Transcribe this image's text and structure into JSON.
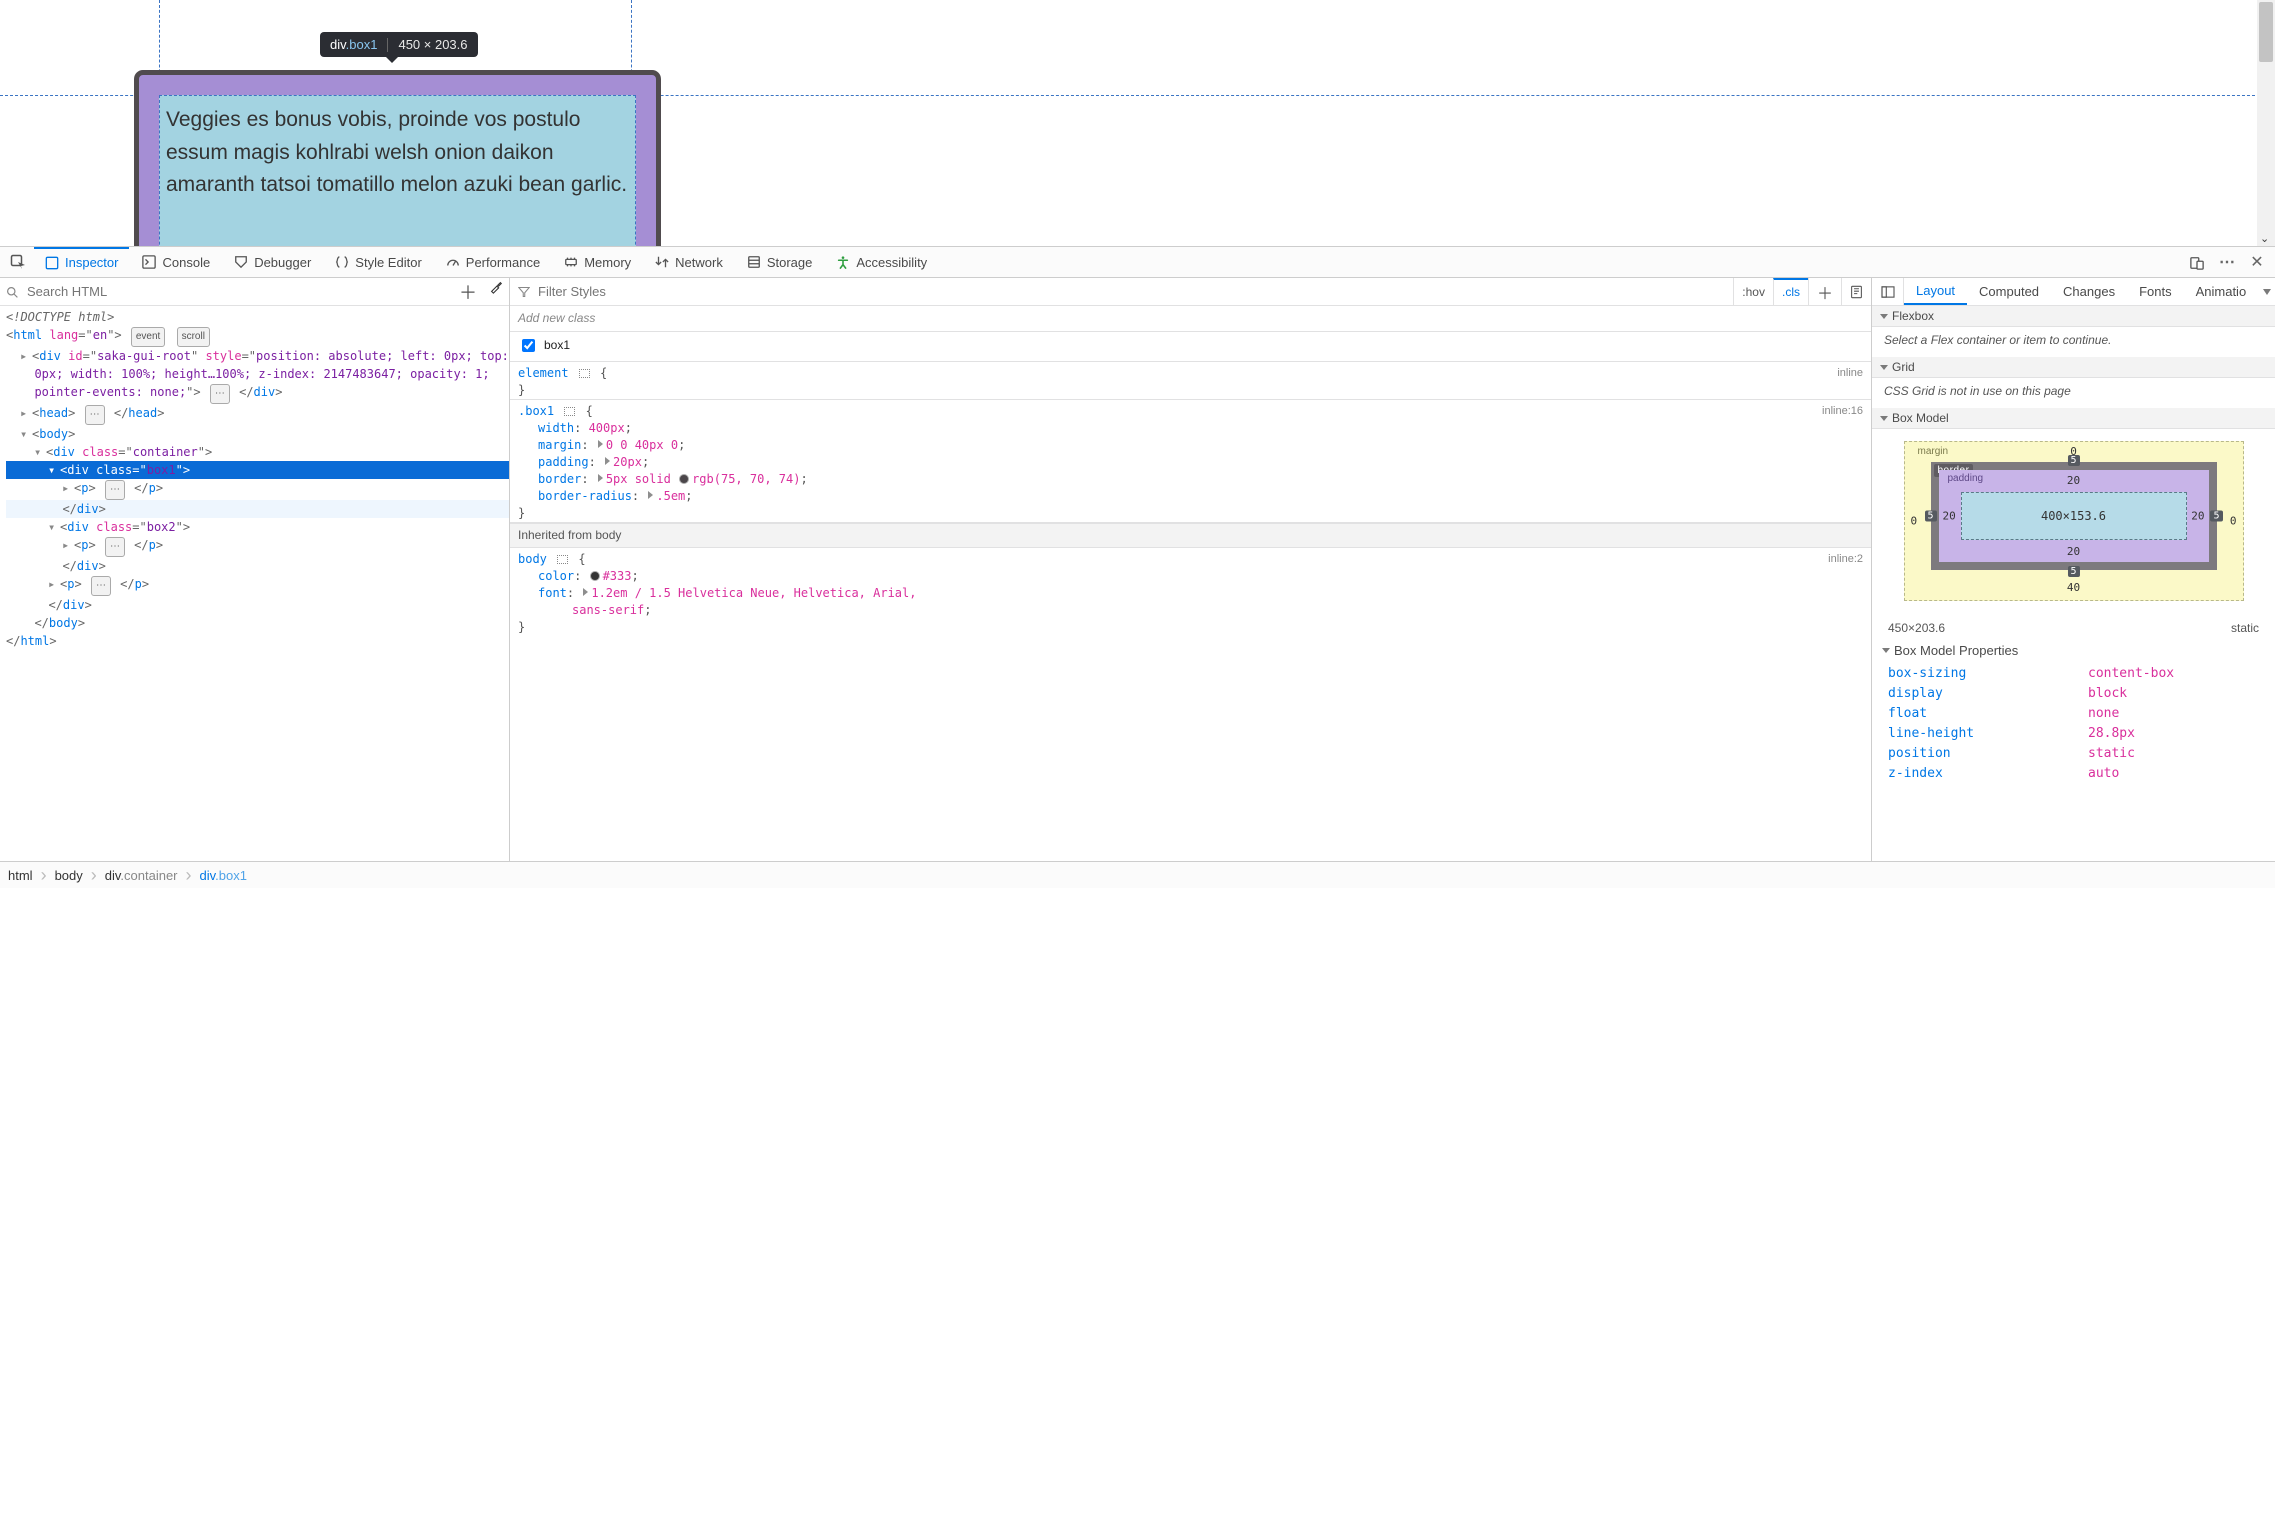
{
  "preview": {
    "text": "Veggies es bonus vobis, proinde vos postulo essum magis kohlrabi welsh onion daikon amaranth tatsoi tomatillo melon azuki bean garlic.",
    "infotip_tag": "div",
    "infotip_class": ".box1",
    "infotip_dims": "450 × 203.6"
  },
  "toolbar": {
    "inspector": "Inspector",
    "console": "Console",
    "debugger": "Debugger",
    "style_editor": "Style Editor",
    "performance": "Performance",
    "memory": "Memory",
    "network": "Network",
    "storage": "Storage",
    "accessibility": "Accessibility"
  },
  "markup": {
    "search_placeholder": "Search HTML",
    "doctype": "<!DOCTYPE html>",
    "html_open": "<html lang=\"en\">",
    "event_badge": "event",
    "scroll_badge": "scroll",
    "saka_div_line1": "<div id=\"saka-gui-root\" style=\"position: absolute; left: 0px; top: ",
    "saka_div_line2": "0px; width: 100%; height…100%; z-index: 2147483647; opacity: 1; ",
    "saka_div_line3": "pointer-events: none;\">",
    "ellips_box": "⋯",
    "saka_close": "</div>",
    "head_open": "<head>",
    "head_close": "</head>",
    "body_open": "<body>",
    "container_open": "<div class=\"container\">",
    "box1_open": "<div class=\"box1\">",
    "p_open": "<p>",
    "p_close": "</p>",
    "div_close": "</div>",
    "box2_open": "<div class=\"box2\">",
    "body_close": "</body>",
    "html_close": "</html>"
  },
  "rules": {
    "filter_placeholder": "Filter Styles",
    "hov": ":hov",
    "cls": ".cls",
    "add_new_class": "Add new class",
    "checkbox_label": "box1",
    "origin_inline": "inline",
    "origin_inline16": "inline:16",
    "origin_inline2": "inline:2",
    "element_selector": "element",
    "box1_selector": ".box1",
    "decl_width": {
      "prop": "width",
      "val": "400px"
    },
    "decl_margin": {
      "prop": "margin",
      "val": "0 0 40px 0"
    },
    "decl_padding": {
      "prop": "padding",
      "val": "20px"
    },
    "decl_border": {
      "prop": "border",
      "val1": "5px solid",
      "color": "rgb(75, 70, 74)"
    },
    "decl_radius": {
      "prop": "border-radius",
      "val": ".5em"
    },
    "inherited_label": "Inherited from body",
    "body_selector": "body",
    "decl_color": {
      "prop": "color",
      "val": "#333"
    },
    "decl_font": {
      "prop": "font",
      "val": "1.2em / 1.5 Helvetica Neue, Helvetica, Arial, ",
      "val2": "sans-serif"
    }
  },
  "side": {
    "tabs": {
      "layout": "Layout",
      "computed": "Computed",
      "changes": "Changes",
      "fonts": "Fonts",
      "animations": "Animatio"
    },
    "flexbox_header": "Flexbox",
    "flexbox_msg": "Select a Flex container or item to continue.",
    "grid_header": "Grid",
    "grid_msg": "CSS Grid is not in use on this page",
    "boxmodel_header": "Box Model",
    "bm": {
      "margin_label": "margin",
      "border_label": "border",
      "padding_label": "padding",
      "content": "400×153.6",
      "m_top": "0",
      "m_right": "0",
      "m_bottom": "40",
      "m_left": "0",
      "b_top": "5",
      "b_right": "5",
      "b_bottom": "5",
      "b_left": "5",
      "p_top": "20",
      "p_right": "20",
      "p_bottom": "20",
      "p_left": "20",
      "size": "450×203.6",
      "position": "static"
    },
    "props_header": "Box Model Properties",
    "props": [
      {
        "k": "box-sizing",
        "v": "content-box"
      },
      {
        "k": "display",
        "v": "block"
      },
      {
        "k": "float",
        "v": "none"
      },
      {
        "k": "line-height",
        "v": "28.8px"
      },
      {
        "k": "position",
        "v": "static"
      },
      {
        "k": "z-index",
        "v": "auto"
      }
    ]
  },
  "crumbs": {
    "c1": "html",
    "c2_t": "body",
    "c3_t": "div",
    "c3_c": ".container",
    "c4_t": "div",
    "c4_c": ".box1"
  }
}
